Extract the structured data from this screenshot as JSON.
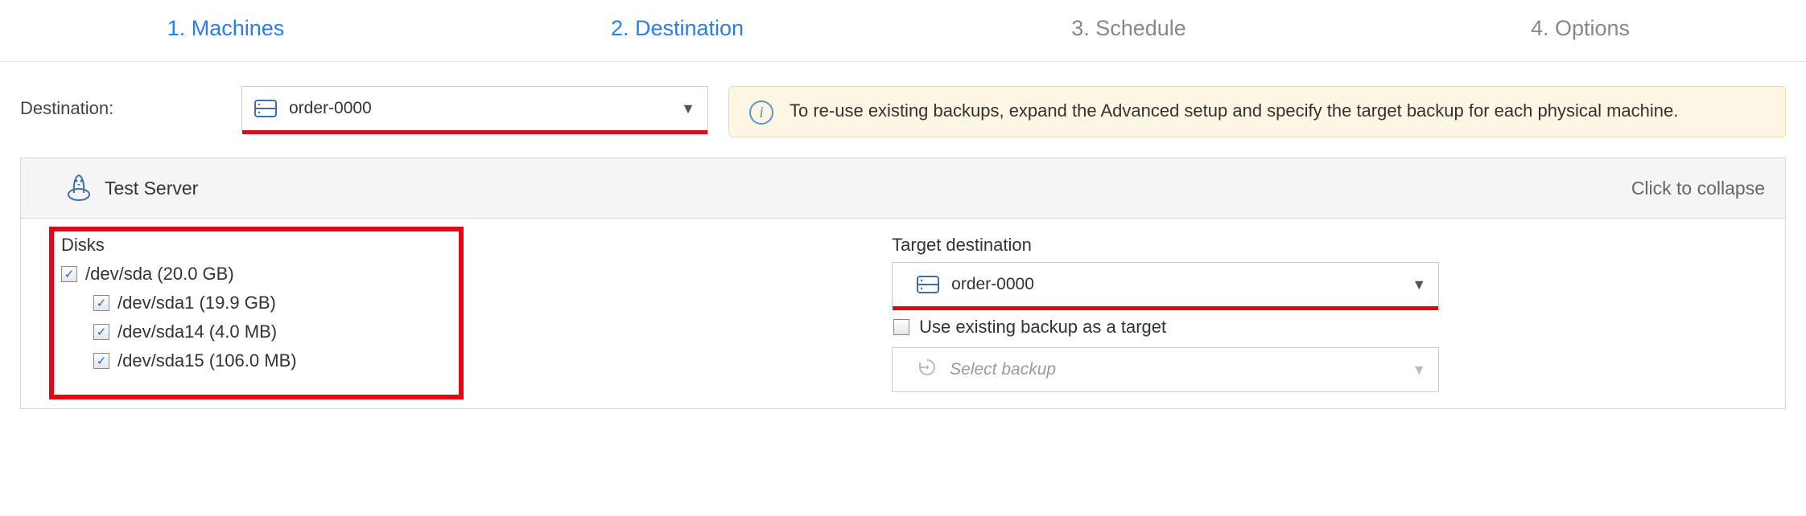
{
  "steps": {
    "machines": "1. Machines",
    "destination": "2. Destination",
    "schedule": "3. Schedule",
    "options": "4. Options"
  },
  "destination_label": "Destination:",
  "destination_value": "order-0000",
  "info_banner": "To re-use existing backups, expand the Advanced setup and specify the target backup for each physical machine.",
  "server": {
    "name": "Test Server",
    "collapse_hint": "Click to collapse"
  },
  "disks": {
    "title": "Disks",
    "root": "/dev/sda (20.0 GB)",
    "partitions": [
      "/dev/sda1 (19.9 GB)",
      "/dev/sda14 (4.0 MB)",
      "/dev/sda15 (106.0 MB)"
    ]
  },
  "target": {
    "label": "Target destination",
    "value": "order-0000",
    "use_existing_label": "Use existing backup as a target",
    "select_backup_placeholder": "Select backup"
  }
}
